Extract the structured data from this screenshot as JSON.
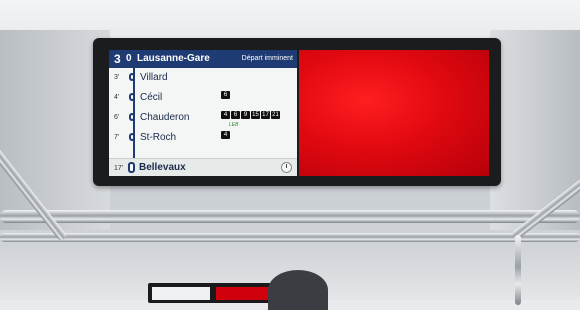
{
  "display": {
    "line_number": "3",
    "header": {
      "time": "0",
      "stop": "Lausanne-Gare",
      "status": "Départ imminent"
    },
    "stops": [
      {
        "time": "3'",
        "name": "Villard",
        "badges": []
      },
      {
        "time": "4'",
        "name": "Cécil",
        "badges": [
          "6"
        ]
      },
      {
        "time": "6'",
        "name": "Chauderon",
        "badges": [
          "4",
          "6",
          "9",
          "15",
          "17",
          "21"
        ],
        "note": "LEB"
      },
      {
        "time": "7'",
        "name": "St-Roch",
        "badges": [
          "4"
        ]
      }
    ],
    "terminus": {
      "time": "17'",
      "name": "Bellevaux"
    }
  },
  "colors": {
    "header_bg": "#1f3b73",
    "ad_red": "#e10910"
  },
  "icons": {
    "clock": "clock-icon"
  }
}
